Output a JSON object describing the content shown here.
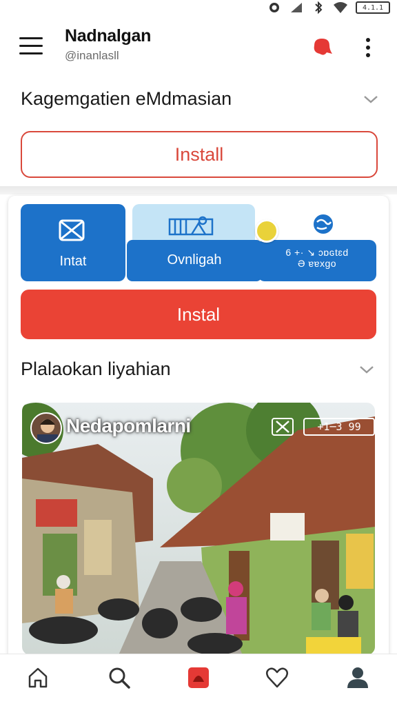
{
  "status_bar": {
    "battery_text": "4.1.1",
    "icons": [
      "alarm-icon",
      "signal-icon",
      "bluetooth-icon",
      "wifi-icon",
      "battery-icon"
    ]
  },
  "header": {
    "title": "Nadnalgan",
    "handle": "@inanlasll",
    "icons": [
      "menu-icon",
      "notification-icon",
      "more-vertical-icon"
    ],
    "accent_color": "#e53935"
  },
  "section_1": {
    "title": "Kagemgatien eMdmasian",
    "install_label": "Install"
  },
  "tabs": [
    {
      "label": "Intat",
      "icon": "mail-icon"
    },
    {
      "label": "Ovnligah",
      "icon": "gallery-icon"
    },
    {
      "label": "6 +· ↘ ɔɒɢtɛd\nƏ ɐɐxɡo",
      "icon": "globe-icon"
    }
  ],
  "install_button": {
    "label": "Instal"
  },
  "section_2": {
    "title": "Plalaokan liyahian"
  },
  "photo": {
    "overlay_name": "Nedapomlarni",
    "counter": "+1─3 99"
  },
  "bottom_nav": [
    {
      "name": "home",
      "icon": "home-icon"
    },
    {
      "name": "search",
      "icon": "search-icon"
    },
    {
      "name": "create",
      "icon": "create-icon"
    },
    {
      "name": "favorites",
      "icon": "heart-icon"
    },
    {
      "name": "profile",
      "icon": "profile-icon"
    }
  ],
  "colors": {
    "primary_blue": "#1d72c9",
    "light_blue": "#c4e4f6",
    "red": "#ea4335",
    "outline_red": "#d9483b"
  }
}
